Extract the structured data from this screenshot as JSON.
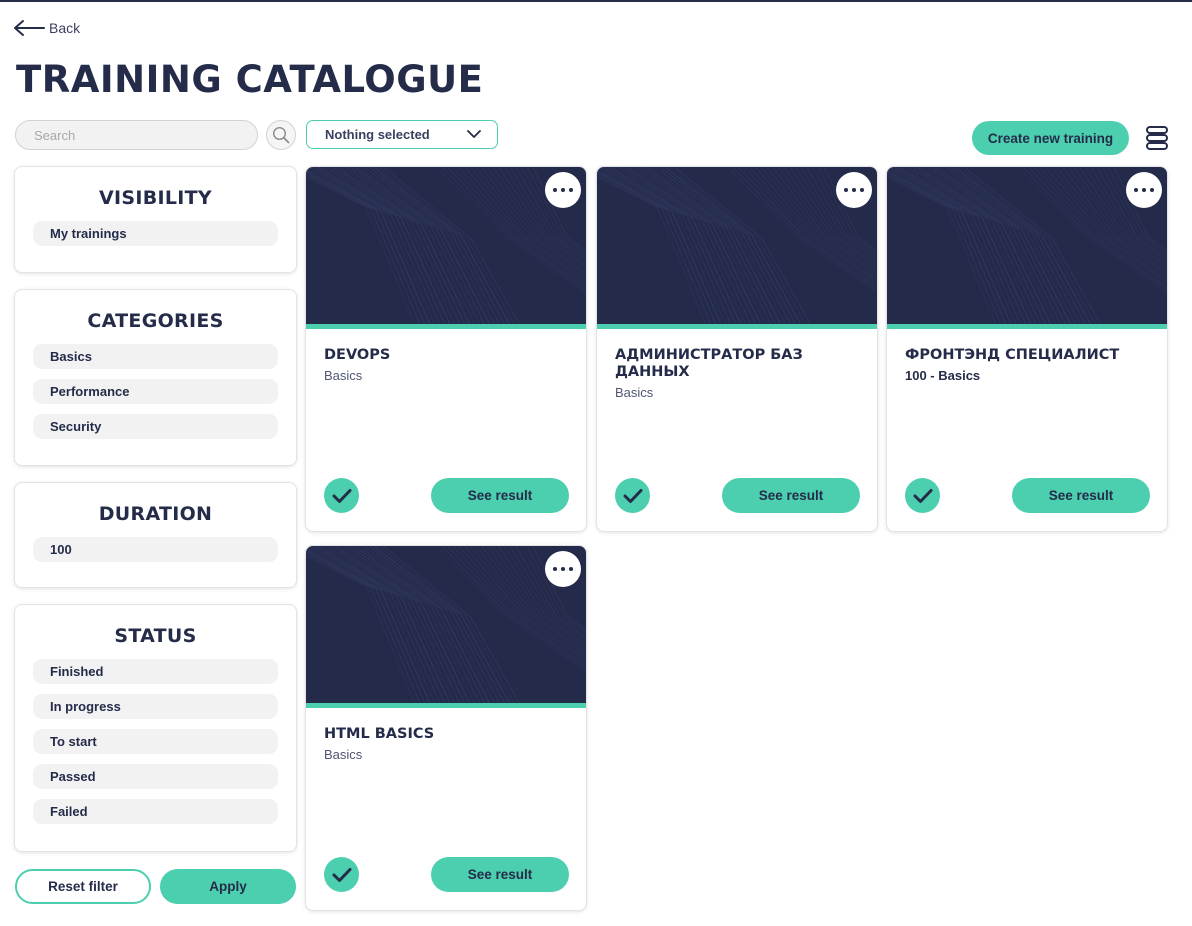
{
  "nav": {
    "back_label": "Back"
  },
  "page": {
    "title": "TRAINING CATALOGUE"
  },
  "search": {
    "placeholder": "Search",
    "value": ""
  },
  "dropdown": {
    "selected": "Nothing selected"
  },
  "toolbar": {
    "create_label": "Create new training",
    "view_toggle_icon": "list-view-icon"
  },
  "filters": {
    "visibility": {
      "title": "VISIBILITY",
      "items": [
        "My trainings"
      ]
    },
    "categories": {
      "title": "CATEGORIES",
      "items": [
        "Basics",
        "Performance",
        "Security"
      ]
    },
    "duration": {
      "title": "DURATION",
      "items": [
        "100"
      ]
    },
    "status": {
      "title": "STATUS",
      "items": [
        "Finished",
        "In progress",
        "To start",
        "Passed",
        "Failed"
      ]
    },
    "reset_label": "Reset filter",
    "apply_label": "Apply"
  },
  "cards": [
    {
      "title": "DEVOPS",
      "subtitle": "Basics",
      "button": "See result"
    },
    {
      "title": "АДМИНИСТРАТОР БАЗ ДАННЫХ",
      "subtitle": "Basics",
      "button": "See result"
    },
    {
      "title": "ФРОНТЭНД СПЕЦИАЛИСТ",
      "subtitle": "100 - Basics",
      "button": "See result"
    },
    {
      "title": "HTML BASICS",
      "subtitle": "Basics",
      "button": "See result"
    }
  ],
  "colors": {
    "accent": "#4ccfae",
    "navy": "#252c4a",
    "chip_bg": "#f2f2f2"
  }
}
